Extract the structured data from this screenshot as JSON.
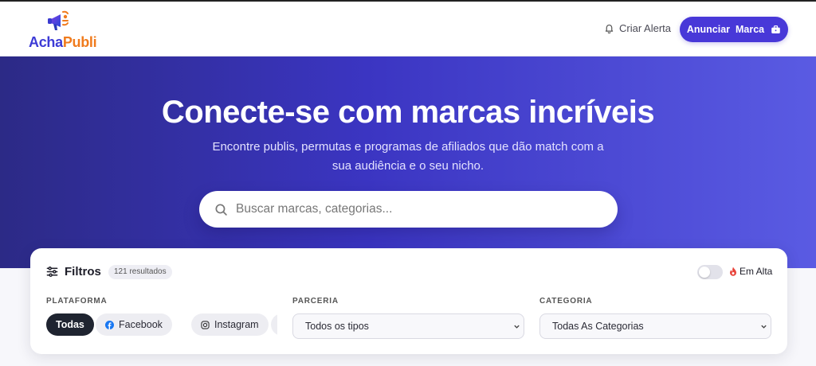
{
  "header": {
    "logo_part1": "Acha",
    "logo_part2": "Publi",
    "alert_label": "Criar Alerta",
    "cta_label": "Anunciar  Marca"
  },
  "hero": {
    "title": "Conecte-se com marcas incríveis",
    "subtitle": "Encontre publis, permutas e programas de afiliados que dão match com a sua audiência e o seu nicho.",
    "search_placeholder": "Buscar marcas, categorias..."
  },
  "filters": {
    "title": "Filtros",
    "results": "121 resultados",
    "trending_label": "Em Alta",
    "trending_enabled": false,
    "platform_label": "PLATAFORMA",
    "platforms": [
      {
        "label": "Todas",
        "icon": "none",
        "active": true
      },
      {
        "label": "Facebook",
        "icon": "facebook-icon",
        "active": false
      },
      {
        "label": "Instagram",
        "icon": "instagram-icon",
        "active": false
      },
      {
        "label": "",
        "icon": "pinterest-icon",
        "active": false
      }
    ],
    "partnership_label": "PARCERIA",
    "partnership_value": "Todos os tipos",
    "category_label": "CATEGORIA",
    "category_value": "Todas As Categorias"
  },
  "colors": {
    "brand_primary": "#4838d8",
    "brand_orange": "#f07b1d",
    "hero_start": "#2c2a86",
    "hero_end": "#5a5be3"
  }
}
